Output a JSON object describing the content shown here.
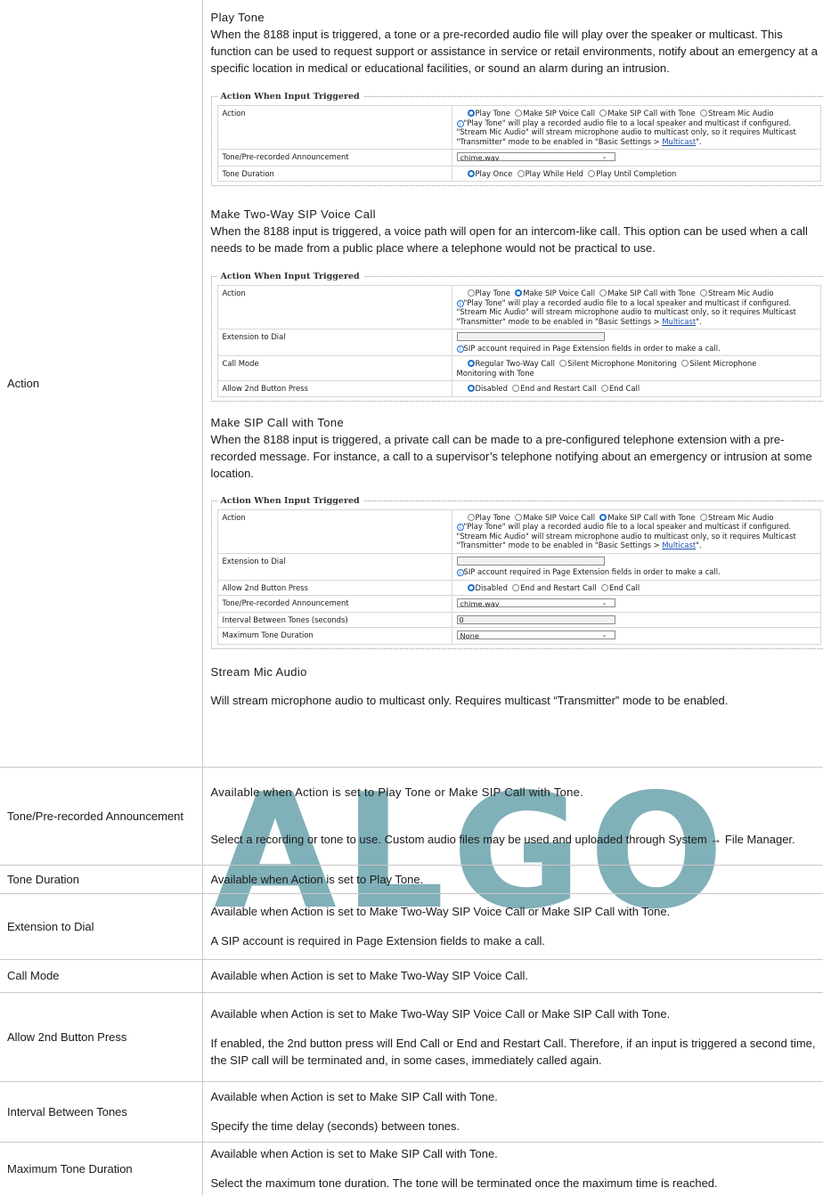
{
  "watermark": "ALGO",
  "action_row": {
    "label": "Action",
    "play_tone": {
      "title": "Play Tone",
      "body": "When the 8188 input is triggered, a tone or a pre-recorded audio file will play over the speaker or multicast. This function can be used to request support or assistance in service or retail environments, notify about an emergency at a specific location in medical or educational facilities, or sound an alarm during an intrusion."
    },
    "two_way": {
      "title": "Make Two-Way SIP Voice Call",
      "body": "When the 8188 input is triggered, a voice path will open for an intercom-like call. This option can be used when a call needs to be made from a public place where a telephone would not be practical to use."
    },
    "sip_tone": {
      "title": "Make SIP Call with Tone",
      "body": "When the 8188 input is triggered, a private call can be made to a pre-configured telephone extension with a pre-recorded message. For instance, a call to a supervisor’s telephone notifying about an emergency or intrusion at some location."
    },
    "stream_mic": {
      "title": "Stream Mic Audio",
      "body": "Will stream microphone audio to multicast only. Requires multicast “Transmitter” mode to be enabled."
    }
  },
  "panel": {
    "legend": "Action When Input Triggered",
    "action_label": "Action",
    "action_options": [
      "Play Tone",
      "Make SIP Voice Call",
      "Make SIP Call with Tone",
      "Stream Mic Audio"
    ],
    "note_1": "\"Play Tone\" will play a recorded audio file to a local speaker and multicast if configured.",
    "note_2": "\"Stream Mic Audio\" will stream microphone audio to multicast only, so it requires Multicast",
    "note_3": "\"Transmitter\" mode to be enabled in \"Basic Settings > ",
    "note_link": "Multicast",
    "note_end": "\".",
    "tone_label": "Tone/Pre-recorded Announcement",
    "tone_value": "chime.wav",
    "duration_label": "Tone Duration",
    "duration_options": [
      "Play Once",
      "Play While Held",
      "Play Until Completion"
    ],
    "ext_label": "Extension to Dial",
    "ext_note": "SIP account required in Page Extension fields in order to make a call.",
    "call_mode_label": "Call Mode",
    "call_mode_options": [
      "Regular Two-Way Call",
      "Silent Microphone Monitoring",
      "Silent Microphone"
    ],
    "call_mode_wrap": "Monitoring with Tone",
    "press_label": "Allow 2nd Button Press",
    "press_options": [
      "Disabled",
      "End and Restart Call",
      "End Call"
    ],
    "interval_label": "Interval Between Tones (seconds)",
    "interval_value": "0",
    "max_label": "Maximum Tone Duration",
    "max_value": "None"
  },
  "rows": {
    "tone": {
      "label": "Tone/Pre-recorded Announcement",
      "p1": "Available when Action is set to Play Tone or Make SIP Call with Tone.",
      "p2": "Select a recording or tone to use. Custom audio files may be used and uploaded through System → File Manager."
    },
    "duration": {
      "label": "Tone Duration",
      "p1": "Available when Action is set to Play Tone."
    },
    "ext": {
      "label": "Extension to Dial",
      "p1": "Available when Action is set to Make Two-Way SIP Voice Call or Make SIP Call with Tone.",
      "p2": "A SIP account is required in Page Extension fields to make a call."
    },
    "callmode": {
      "label": "Call Mode",
      "p1": "Available when Action is set to Make Two-Way SIP Voice Call."
    },
    "press": {
      "label": "Allow 2nd Button Press",
      "p1": "Available when Action is set to Make Two-Way SIP Voice Call or Make SIP Call with Tone.",
      "p2": "If enabled, the 2nd button press will End Call or End and Restart Call. Therefore, if an input is triggered a second time, the SIP call will be terminated and, in some cases, immediately called again."
    },
    "interval": {
      "label": "Interval Between Tones",
      "p1": "Available when Action is set to Make SIP Call with Tone.",
      "p2": "Specify the time delay (seconds) between tones."
    },
    "max": {
      "label": "Maximum Tone Duration",
      "p1": "Available when Action is set to Make SIP Call with Tone.",
      "p2": "Select the maximum tone duration. The tone will be terminated once the maximum time is reached."
    }
  }
}
